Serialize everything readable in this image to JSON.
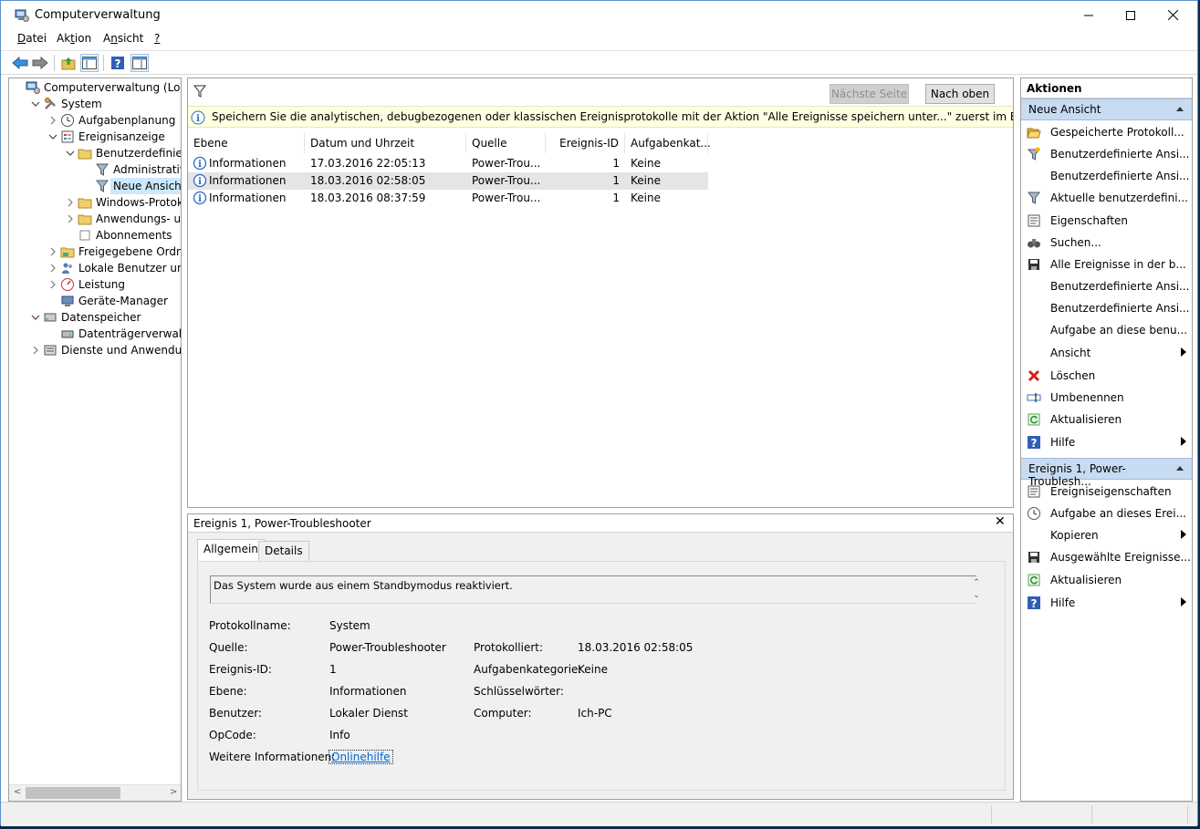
{
  "window": {
    "title": "Computerverwaltung"
  },
  "menu": [
    {
      "label": "Datei",
      "u": "D",
      "rest": "atei"
    },
    {
      "label": "Aktion",
      "pre": "Ak",
      "u": "t",
      "rest": "ion"
    },
    {
      "label": "Ansicht",
      "pre": "A",
      "u": "n",
      "rest": "sicht"
    },
    {
      "label": "?",
      "u": "?",
      "rest": ""
    }
  ],
  "tree": [
    {
      "label": "Computerverwaltung (Lokal)",
      "level": 0,
      "expander": "",
      "icon": "computer-management-icon",
      "selected": false
    },
    {
      "label": "System",
      "level": 1,
      "expander": "open",
      "icon": "system-tools-icon",
      "selected": false
    },
    {
      "label": "Aufgabenplanung",
      "level": 2,
      "expander": "closed",
      "icon": "clock-icon",
      "selected": false
    },
    {
      "label": "Ereignisanzeige",
      "level": 2,
      "expander": "open",
      "icon": "event-viewer-icon",
      "selected": false
    },
    {
      "label": "Benutzerdefinierte A",
      "level": 3,
      "expander": "open",
      "icon": "folder-icon",
      "selected": false
    },
    {
      "label": "Administrative E",
      "level": 4,
      "expander": "",
      "icon": "filter-icon",
      "selected": false
    },
    {
      "label": "Neue Ansicht",
      "level": 4,
      "expander": "",
      "icon": "filter-icon",
      "selected": true
    },
    {
      "label": "Windows-Protokolle",
      "level": 3,
      "expander": "closed",
      "icon": "folder-icon",
      "selected": false
    },
    {
      "label": "Anwendungs- und D",
      "level": 3,
      "expander": "closed",
      "icon": "folder-icon",
      "selected": false
    },
    {
      "label": "Abonnements",
      "level": 3,
      "expander": "",
      "icon": "subscriptions-icon",
      "selected": false
    },
    {
      "label": "Freigegebene Ordner",
      "level": 2,
      "expander": "closed",
      "icon": "shared-folder-icon",
      "selected": false
    },
    {
      "label": "Lokale Benutzer und Gr",
      "level": 2,
      "expander": "closed",
      "icon": "users-icon",
      "selected": false
    },
    {
      "label": "Leistung",
      "level": 2,
      "expander": "closed",
      "icon": "performance-icon",
      "selected": false
    },
    {
      "label": "Geräte-Manager",
      "level": 2,
      "expander": "",
      "icon": "device-manager-icon",
      "selected": false
    },
    {
      "label": "Datenspeicher",
      "level": 1,
      "expander": "open",
      "icon": "storage-icon",
      "selected": false
    },
    {
      "label": "Datenträgerverwaltung",
      "level": 2,
      "expander": "",
      "icon": "disk-icon",
      "selected": false
    },
    {
      "label": "Dienste und Anwendungen",
      "level": 1,
      "expander": "closed",
      "icon": "services-icon",
      "selected": false
    }
  ],
  "center": {
    "next_page": "Nächste Seite",
    "to_top": "Nach oben",
    "info": "Speichern Sie die analytischen, debugbezogenen oder klassischen Ereignisprotokolle mit der Aktion \"Alle Ereignisse speichern unter...\" zuerst im EVTX-Format, um die",
    "columns": [
      "Ebene",
      "Datum und Uhrzeit",
      "Quelle",
      "Ereignis-ID",
      "Aufgabenkat..."
    ],
    "rows": [
      {
        "level": "Informationen",
        "date": "17.03.2016 22:05:13",
        "source": "Power-Trou...",
        "id": "1",
        "task": "Keine"
      },
      {
        "level": "Informationen",
        "date": "18.03.2016 02:58:05",
        "source": "Power-Trou...",
        "id": "1",
        "task": "Keine"
      },
      {
        "level": "Informationen",
        "date": "18.03.2016 08:37:59",
        "source": "Power-Trou...",
        "id": "1",
        "task": "Keine"
      }
    ],
    "selected_row": 1
  },
  "detail": {
    "title": "Ereignis 1, Power-Troubleshooter",
    "tabs": [
      "Allgemein",
      "Details"
    ],
    "description": "Das System wurde aus einem Standbymodus reaktiviert.",
    "fields": {
      "protokollname_label": "Protokollname:",
      "protokollname": "System",
      "quelle_label": "Quelle:",
      "quelle": "Power-Troubleshooter",
      "protokolliert_label": "Protokolliert:",
      "protokolliert": "18.03.2016 02:58:05",
      "ereignis_id_label": "Ereignis-ID:",
      "ereignis_id": "1",
      "aufgabenkategorie_label": "Aufgabenkategorie:",
      "aufgabenkategorie": "Keine",
      "ebene_label": "Ebene:",
      "ebene": "Informationen",
      "schluesselwoerter_label": "Schlüsselwörter:",
      "schluesselwoerter": "",
      "benutzer_label": "Benutzer:",
      "benutzer": "Lokaler Dienst",
      "computer_label": "Computer:",
      "computer": "Ich-PC",
      "opcode_label": "OpCode:",
      "opcode": "Info",
      "weitere_label": "Weitere Informationen:",
      "weitere_link": "Onlinehilfe"
    }
  },
  "actions": {
    "title": "Aktionen",
    "section1": "Neue Ansicht",
    "items1": [
      {
        "label": "Gespeicherte Protokoll...",
        "icon": "open-folder-icon",
        "sub": false
      },
      {
        "label": "Benutzerdefinierte Ansi...",
        "icon": "filter-star-icon",
        "sub": false
      },
      {
        "label": "Benutzerdefinierte Ansi...",
        "icon": "",
        "sub": false
      },
      {
        "label": "Aktuelle benutzerdefini...",
        "icon": "filter-icon",
        "sub": false
      },
      {
        "label": "Eigenschaften",
        "icon": "properties-icon",
        "sub": false
      },
      {
        "label": "Suchen...",
        "icon": "binoculars-icon",
        "sub": false
      },
      {
        "label": "Alle Ereignisse in der b...",
        "icon": "save-icon",
        "sub": false
      },
      {
        "label": "Benutzerdefinierte Ansi...",
        "icon": "",
        "sub": false
      },
      {
        "label": "Benutzerdefinierte Ansi...",
        "icon": "",
        "sub": false
      },
      {
        "label": "Aufgabe an diese benu...",
        "icon": "",
        "sub": false
      },
      {
        "label": "Ansicht",
        "icon": "",
        "sub": true
      },
      {
        "label": "Löschen",
        "icon": "delete-icon",
        "sub": false
      },
      {
        "label": "Umbenennen",
        "icon": "rename-icon",
        "sub": false
      },
      {
        "label": "Aktualisieren",
        "icon": "refresh-icon",
        "sub": false
      },
      {
        "label": "Hilfe",
        "icon": "help-icon",
        "sub": true
      }
    ],
    "section2": "Ereignis 1, Power-Troublesh...",
    "items2": [
      {
        "label": "Ereigniseigenschaften",
        "icon": "properties-icon",
        "sub": false
      },
      {
        "label": "Aufgabe an dieses Erei...",
        "icon": "task-icon",
        "sub": false
      },
      {
        "label": "Kopieren",
        "icon": "",
        "sub": true
      },
      {
        "label": "Ausgewählte Ereignisse...",
        "icon": "save-icon",
        "sub": false
      },
      {
        "label": "Aktualisieren",
        "icon": "refresh-icon",
        "sub": false
      },
      {
        "label": "Hilfe",
        "icon": "help-icon",
        "sub": true
      }
    ]
  }
}
